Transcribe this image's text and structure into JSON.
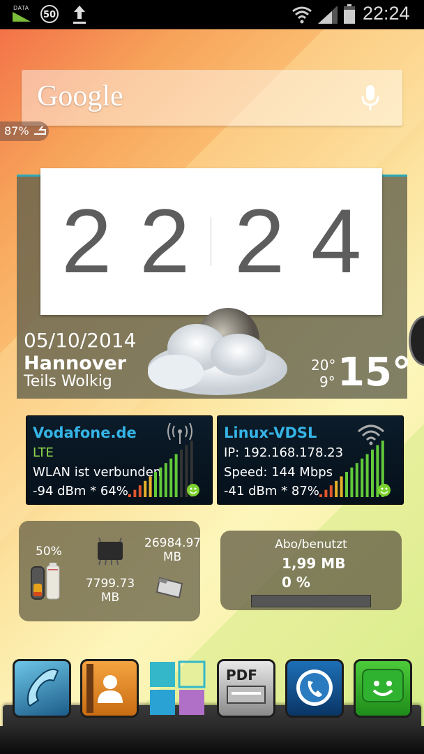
{
  "status_bar": {
    "data_label": "DATA",
    "speed_value": "50",
    "time": "22:24",
    "icons": [
      "data-icon",
      "speed-icon",
      "upload-icon",
      "wifi-icon",
      "signal-icon",
      "battery-icon"
    ]
  },
  "google": {
    "logo_text": "Google",
    "icon": "mic-icon"
  },
  "battery_pill": {
    "text": "87%"
  },
  "clock": {
    "digits": [
      "2",
      "2",
      "2",
      "4"
    ],
    "date": "05/10/2014",
    "city": "Hannover",
    "condition": "Teils Wolkig",
    "temp_high": "20°",
    "temp_low": "9°",
    "temp_now": "15°"
  },
  "network": [
    {
      "name": "Vodafone.de",
      "line1": "LTE",
      "line1_color": "#8fd94a",
      "line2": "WLAN ist verbunden",
      "line3": "-94 dBm * 64%",
      "icon": "antenna-icon"
    },
    {
      "name": "Linux-VDSL",
      "line1": "IP: 192.168.178.23",
      "line1_color": "#ffffff",
      "line2": "Speed: 144 Mbps",
      "line3": "-41 dBm * 87%",
      "icon": "wifi-icon"
    }
  ],
  "system": {
    "battery_pct": "50%",
    "ram_free": "7799.73\nMB",
    "sd_free": "26984.97\nMB"
  },
  "abo": {
    "title": "Abo/benutzt",
    "used": "1,99 MB",
    "percent": "0 %"
  },
  "dock": {
    "apps": [
      "phone-icon",
      "contacts-icon",
      "apps-grid-icon",
      "pdf-icon",
      "whatsapp-icon",
      "messenger-icon"
    ],
    "pdf_label": "PDF"
  },
  "colors": {
    "accent": "#2aa9b8",
    "link_blue": "#35b4e6",
    "signal_green": "#8fd94a"
  }
}
